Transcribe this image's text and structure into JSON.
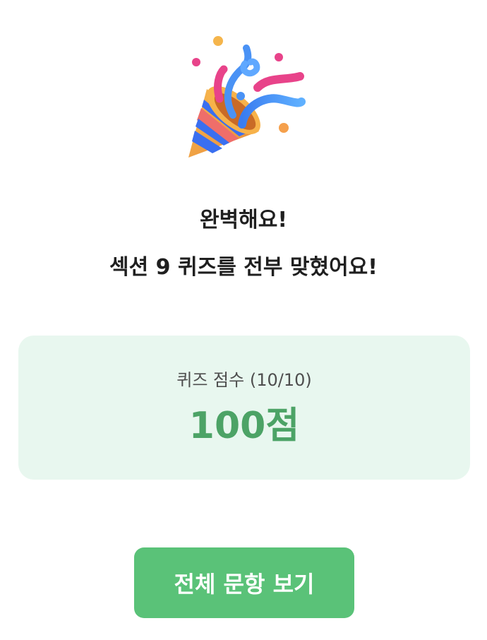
{
  "result": {
    "headline_1": "완벽해요!",
    "headline_2": "섹션 9 퀴즈를 전부 맞혔어요!"
  },
  "score_card": {
    "label": "퀴즈 점수 (10/10)",
    "value": "100점"
  },
  "actions": {
    "view_all_label": "전체 문항 보기"
  },
  "icons": {
    "celebration": "party-popper-icon"
  },
  "colors": {
    "accent_green": "#5ac278",
    "score_green": "#4ca366",
    "card_bg": "#e8f7ef",
    "text_dark": "#1f1f1f"
  }
}
